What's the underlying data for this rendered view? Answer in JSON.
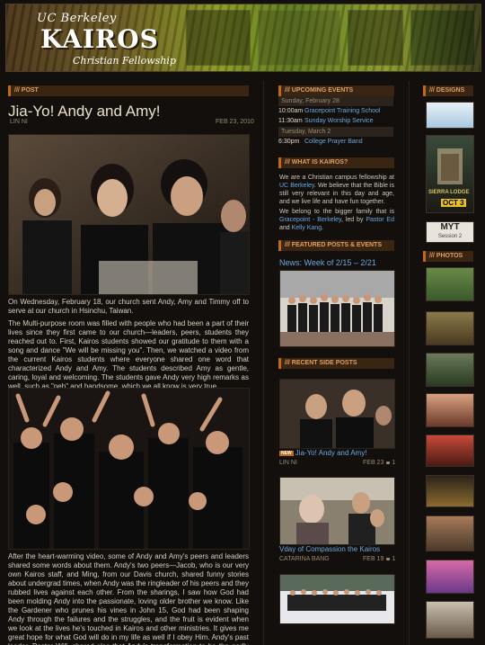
{
  "header": {
    "logo_top": "UC Berkeley",
    "logo_main": "KAIROS",
    "logo_sub": "Christian Fellowship"
  },
  "post_column": {
    "heading": "/// POST",
    "title": "Jia-Yo! Andy and Amy!",
    "author": "LIN NI",
    "date": "FEB 23, 2010",
    "paragraphs": [
      "On Wednesday, February 18, our church sent Andy, Amy and Timmy off to serve at our church in Hsinchu, Taiwan.",
      "The Multi-purpose room was filled with people who had been a part of their lives since they first came to our church—leaders, peers, students they reached out to. First, Kairos students showed our gratitude to them with a song and dance \"We will be missing you\". Then, we watched a video from the current Kairos students where everyone shared one word that characterized Andy and Amy. The students described Amy as gentle, caring, loyal and welcoming. The students gave Andy very high remarks as well, such as \"peh\" and handsome, which we all know is very true.",
      "After the heart-warming video, some of Andy and Amy's peers and leaders shared some words about them. Andy's two peers—Jacob, who is our very own Kairos staff, and Ming, from our Davis church, shared funny stories about undergrad times, when Andy was the ringleader of his peers and they rubbed lives against each other. From the sharings, I saw how God had been molding Andy into the passionate, loving older brother we know. Like the Gardener who prunes his vines in John 15, God had been shaping Andy through the failures and the struggles, and the fruit is evident when we look at the lives he's touched in Kairos and other ministries. It gives me great hope for what God will do in my life as well if I obey Him. Andy's past leader, Pastor Will, shared also that Andy's transformation to be the godly man he is today was truly the amazing work of God. After that, Amy's peers, Helen and Joyce talked about how..."
    ]
  },
  "events": {
    "heading": "/// UPCOMING EVENTS",
    "days": [
      {
        "day": "Sunday, February 28",
        "items": [
          {
            "time": "10:00am",
            "name": "Gracepoint Training School"
          },
          {
            "time": "11:30am",
            "name": "Sunday Worship Service"
          }
        ]
      },
      {
        "day": "Tuesday, March 2",
        "items": [
          {
            "time": "6:30pm",
            "name": "College Prayer Band"
          }
        ]
      }
    ]
  },
  "about": {
    "heading": "/// WHAT IS KAIROS?",
    "p1_pre": "We are a Christian campus fellowship at ",
    "p1_link": "UC Berkeley",
    "p1_post": ". We believe that the Bible is still very relevant in this day and age, and we live life and have fun together.",
    "p2_pre": "We belong to the bigger family that is ",
    "p2_link1": "Gracepoint - Berkeley",
    "p2_mid": ", led by ",
    "p2_link2": "Pastor Ed",
    "p2_and": " and ",
    "p2_link3": "Kelly Kang",
    "p2_end": "."
  },
  "featured": {
    "heading": "/// FEATURED POSTS & EVENTS",
    "title": "News: Week of 2/15 – 2/21"
  },
  "recent": {
    "heading": "/// RECENT SIDE POSTS",
    "posts": [
      {
        "badge": "NEW",
        "title": "Jia-Yo! Andy and Amy!",
        "author": "LIN NI",
        "date": "FEB 23",
        "comments": "1"
      },
      {
        "badge": "",
        "title": "Vday of Compassion the Kairos",
        "author": "CATARINA BANG",
        "date": "FEB 19",
        "comments": "1"
      }
    ]
  },
  "designs": {
    "heading": "/// DESIGNS",
    "poster_text": "SIERRA LODGE",
    "poster_date": "OCT 3",
    "myt_label": "MYT",
    "myt_sub": "Session 2"
  },
  "photos": {
    "heading": "/// PHOTOS"
  },
  "colors": {
    "accent": "#c06a18",
    "link": "#6aa8e0",
    "background": "#120f0c"
  }
}
